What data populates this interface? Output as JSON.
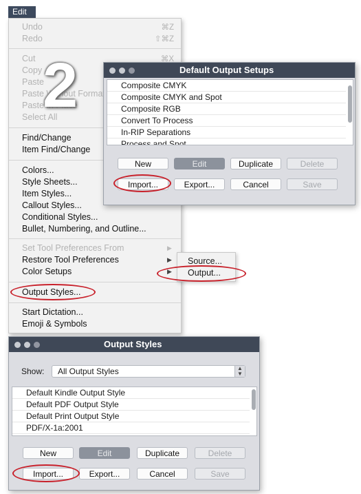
{
  "menubar": {
    "edit_label": "Edit"
  },
  "step_number": "2",
  "edit_menu": {
    "undo": {
      "label": "Undo",
      "shortcut": "⌘Z"
    },
    "redo": {
      "label": "Redo",
      "shortcut": "⇧⌘Z"
    },
    "cut": {
      "label": "Cut",
      "shortcut": "⌘X"
    },
    "copy": {
      "label": "Copy"
    },
    "paste": {
      "label": "Paste"
    },
    "paste_without_formatting": {
      "label": "Paste Without Formatting"
    },
    "paste_in_place": {
      "label": "Paste In Place"
    },
    "select_all": {
      "label": "Select All"
    },
    "find_change": {
      "label": "Find/Change"
    },
    "item_find_change": {
      "label": "Item Find/Change"
    },
    "colors": {
      "label": "Colors..."
    },
    "style_sheets": {
      "label": "Style Sheets..."
    },
    "item_styles": {
      "label": "Item Styles..."
    },
    "callout_styles": {
      "label": "Callout Styles..."
    },
    "conditional_styles": {
      "label": "Conditional Styles..."
    },
    "bullet_numbering": {
      "label": "Bullet, Numbering, and Outline..."
    },
    "set_tool_prefs": {
      "label": "Set Tool Preferences From"
    },
    "restore_tool_prefs": {
      "label": "Restore Tool Preferences"
    },
    "color_setups": {
      "label": "Color Setups"
    },
    "output_styles": {
      "label": "Output Styles..."
    },
    "start_dictation": {
      "label": "Start Dictation..."
    },
    "emoji_symbols": {
      "label": "Emoji & Symbols"
    }
  },
  "color_setups_submenu": {
    "source": "Source...",
    "output": "Output..."
  },
  "default_output_setups": {
    "title": "Default Output Setups",
    "items": [
      "Composite CMYK",
      "Composite CMYK and Spot",
      "Composite RGB",
      "Convert To Process",
      "In-RIP Separations",
      "Process and Spot"
    ],
    "buttons": {
      "new": "New",
      "edit": "Edit",
      "duplicate": "Duplicate",
      "delete": "Delete",
      "import": "Import...",
      "export": "Export...",
      "cancel": "Cancel",
      "save": "Save"
    }
  },
  "output_styles_dialog": {
    "title": "Output Styles",
    "show_label": "Show:",
    "show_value": "All Output Styles",
    "items": [
      "Default Kindle Output Style",
      "Default PDF Output Style",
      "Default Print Output Style",
      "PDF/X-1a:2001"
    ],
    "buttons": {
      "new": "New",
      "edit": "Edit",
      "duplicate": "Duplicate",
      "delete": "Delete",
      "import": "Import...",
      "export": "Export...",
      "cancel": "Cancel",
      "save": "Save"
    }
  },
  "colors": {
    "highlight_ring": "#c8202a",
    "titlebar": "#3f4857",
    "menubar": "#3d4a5e"
  }
}
